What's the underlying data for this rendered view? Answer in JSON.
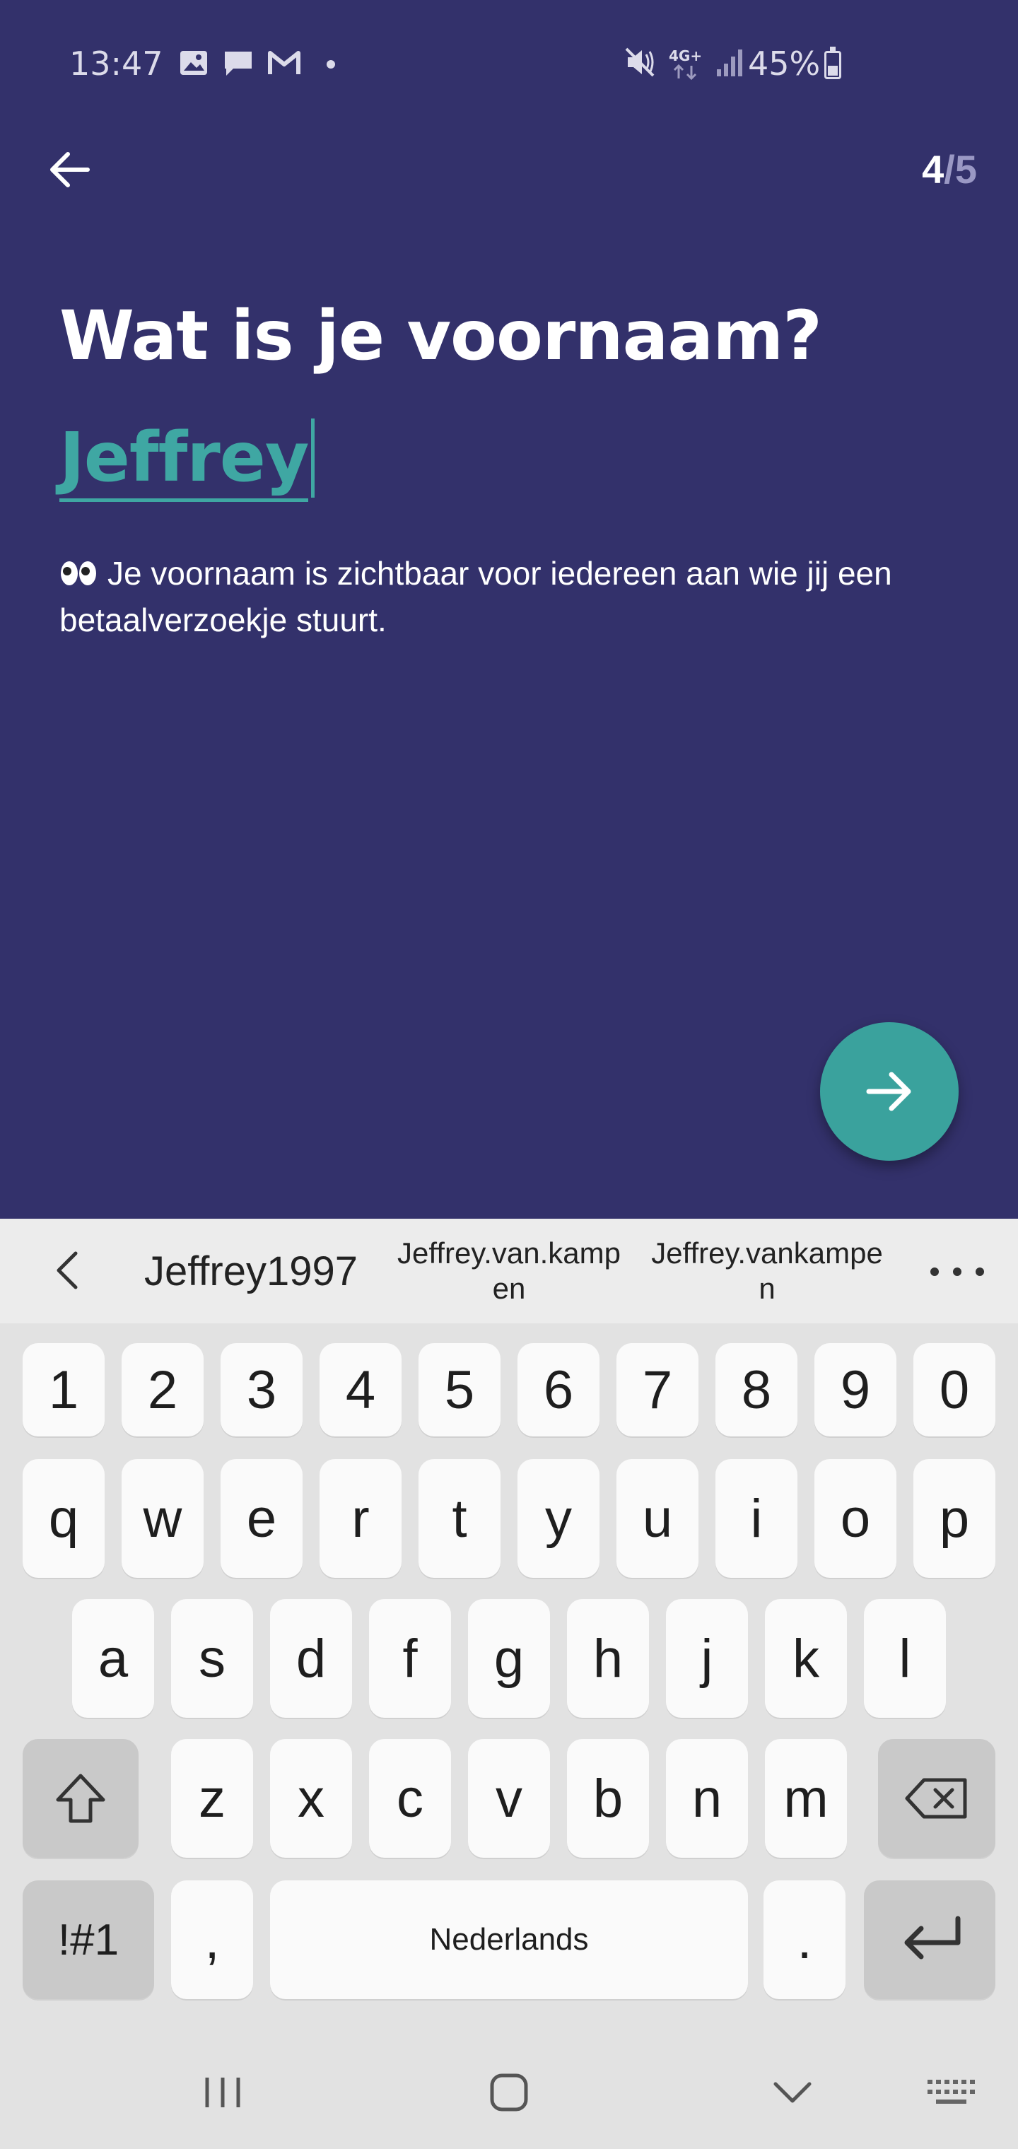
{
  "status_bar": {
    "time": "13:47",
    "network": "4G+",
    "battery_percent": "45%",
    "battery_level": 0.45,
    "icons": [
      "image-icon",
      "message-icon",
      "gmail-icon",
      "notification-dot",
      "mute-icon",
      "network-4g-icon",
      "signal-icon",
      "battery-icon"
    ]
  },
  "header": {
    "back_icon": "arrow-left-icon",
    "step_current": "4",
    "step_total": "/5"
  },
  "main": {
    "title": "Wat is je voornaam?",
    "name_value": "Jeffrey",
    "hint_emoji": "eyes-emoji",
    "hint_text": "Je voornaam is zichtbaar voor iedereen aan wie jij een betaalverzoekje stuurt."
  },
  "next_button": {
    "icon": "arrow-right-icon"
  },
  "keyboard": {
    "suggestions": [
      "Jeffrey1997",
      "Jeffrey.van.kamp en",
      "Jeffrey.vankampe n"
    ],
    "row_numbers": [
      "1",
      "2",
      "3",
      "4",
      "5",
      "6",
      "7",
      "8",
      "9",
      "0"
    ],
    "row_top": [
      "q",
      "w",
      "e",
      "r",
      "t",
      "y",
      "u",
      "i",
      "o",
      "p"
    ],
    "row_middle": [
      "a",
      "s",
      "d",
      "f",
      "g",
      "h",
      "j",
      "k",
      "l"
    ],
    "row_bottom": [
      "z",
      "x",
      "c",
      "v",
      "b",
      "n",
      "m"
    ],
    "symbols_label": "!#1",
    "comma_label": ",",
    "space_label": "Nederlands",
    "period_label": "."
  },
  "colors": {
    "background": "#33316b",
    "accent": "#3aa29d",
    "text": "#ffffff"
  }
}
